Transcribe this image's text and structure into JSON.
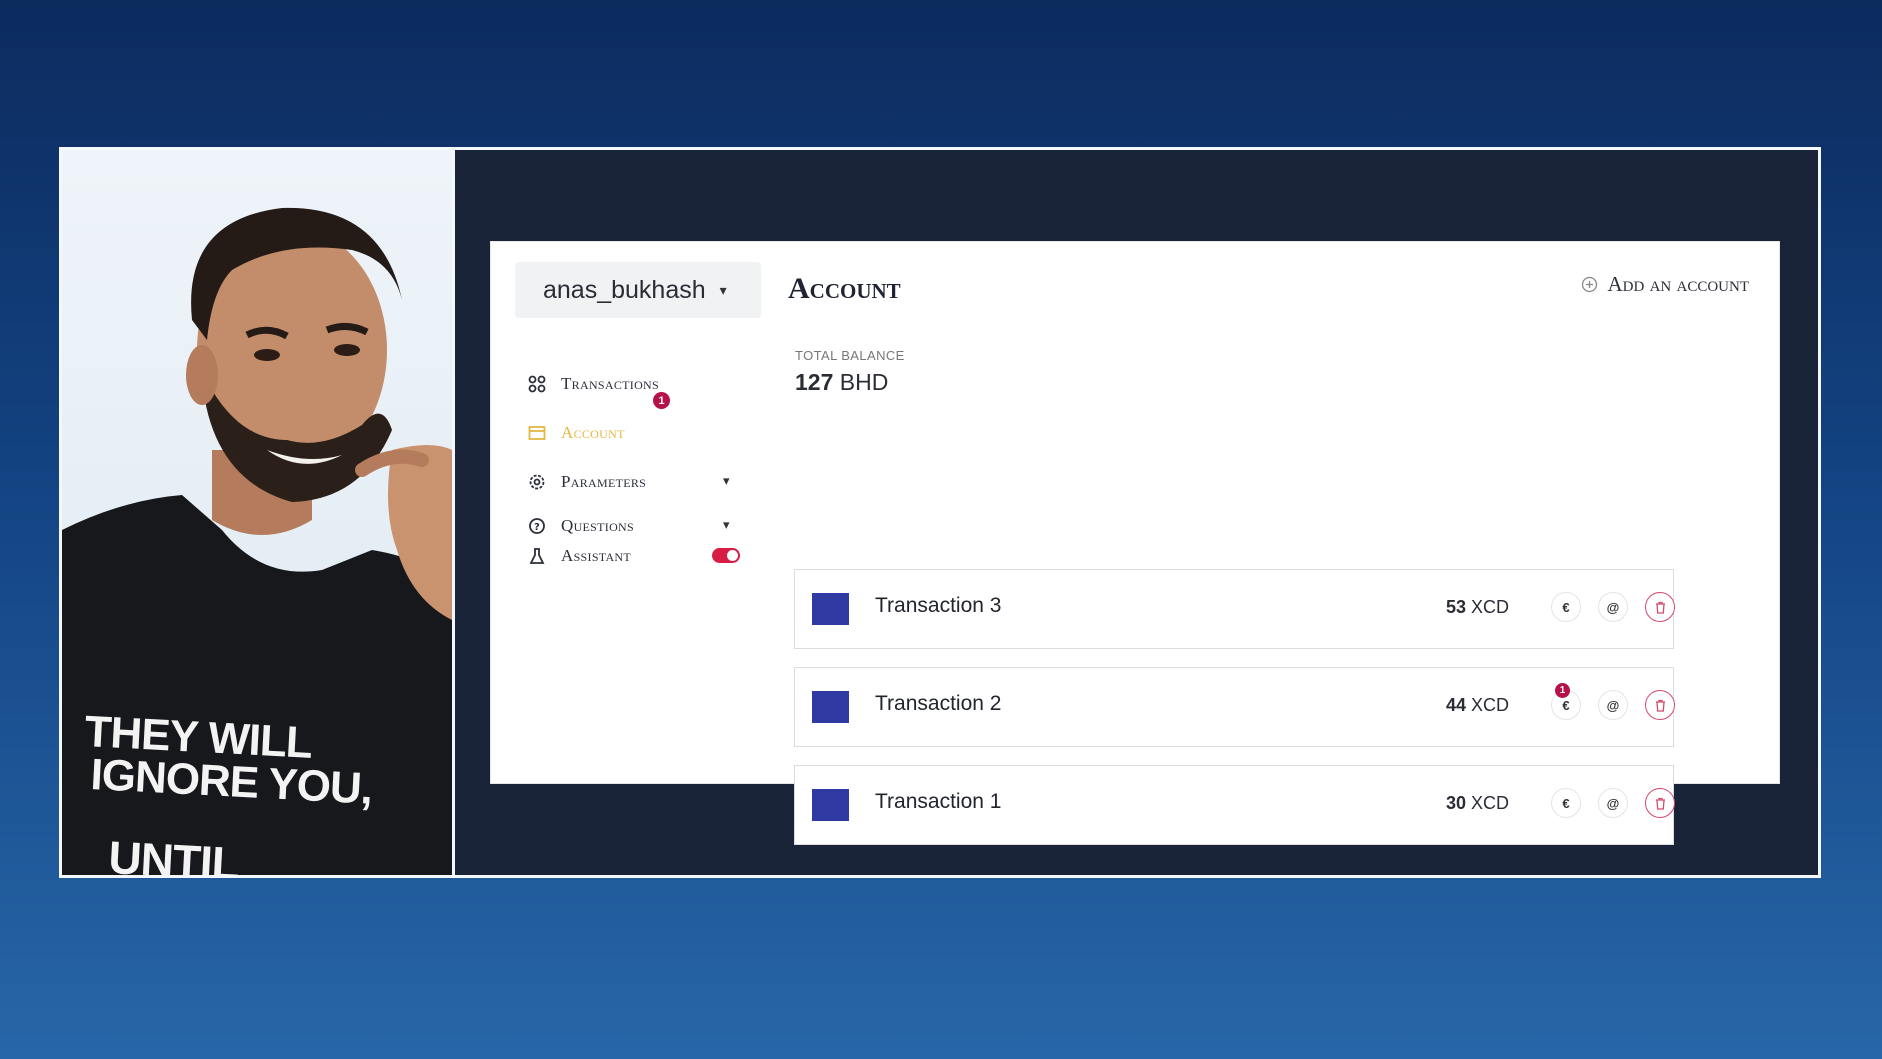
{
  "overlay": {
    "shirt_lines": [
      "THEY WILL",
      "IGNORE YOU,",
      "UNTIL"
    ]
  },
  "sidebar": {
    "user": "anas_bukhash",
    "items": [
      {
        "label": "Transactions",
        "icon": "grid-icon",
        "active": false
      },
      {
        "label": "Account",
        "icon": "wallet-icon",
        "active": true,
        "badge": "1"
      },
      {
        "label": "Parameters",
        "icon": "gear-icon",
        "active": false,
        "expandable": true
      },
      {
        "label": "Questions",
        "icon": "question-icon",
        "active": false,
        "expandable": true
      },
      {
        "label": "Assistant",
        "icon": "flask-icon",
        "active": false,
        "toggle": true
      }
    ]
  },
  "main": {
    "title": "Account",
    "add_account_label": "Add an account",
    "balance_label": "TOTAL BALANCE",
    "balance_amount": "127",
    "balance_currency": "BHD"
  },
  "transactions": [
    {
      "name": "Transaction 3",
      "amount": "53",
      "currency": "XCD",
      "badge": null
    },
    {
      "name": "Transaction 2",
      "amount": "44",
      "currency": "XCD",
      "badge": "1"
    },
    {
      "name": "Transaction 1",
      "amount": "30",
      "currency": "XCD",
      "badge": null
    }
  ],
  "colors": {
    "accent_active": "#e3b841",
    "badge": "#b5124a",
    "toggle_on": "#d81d45",
    "swatch": "#2f3aa3"
  }
}
